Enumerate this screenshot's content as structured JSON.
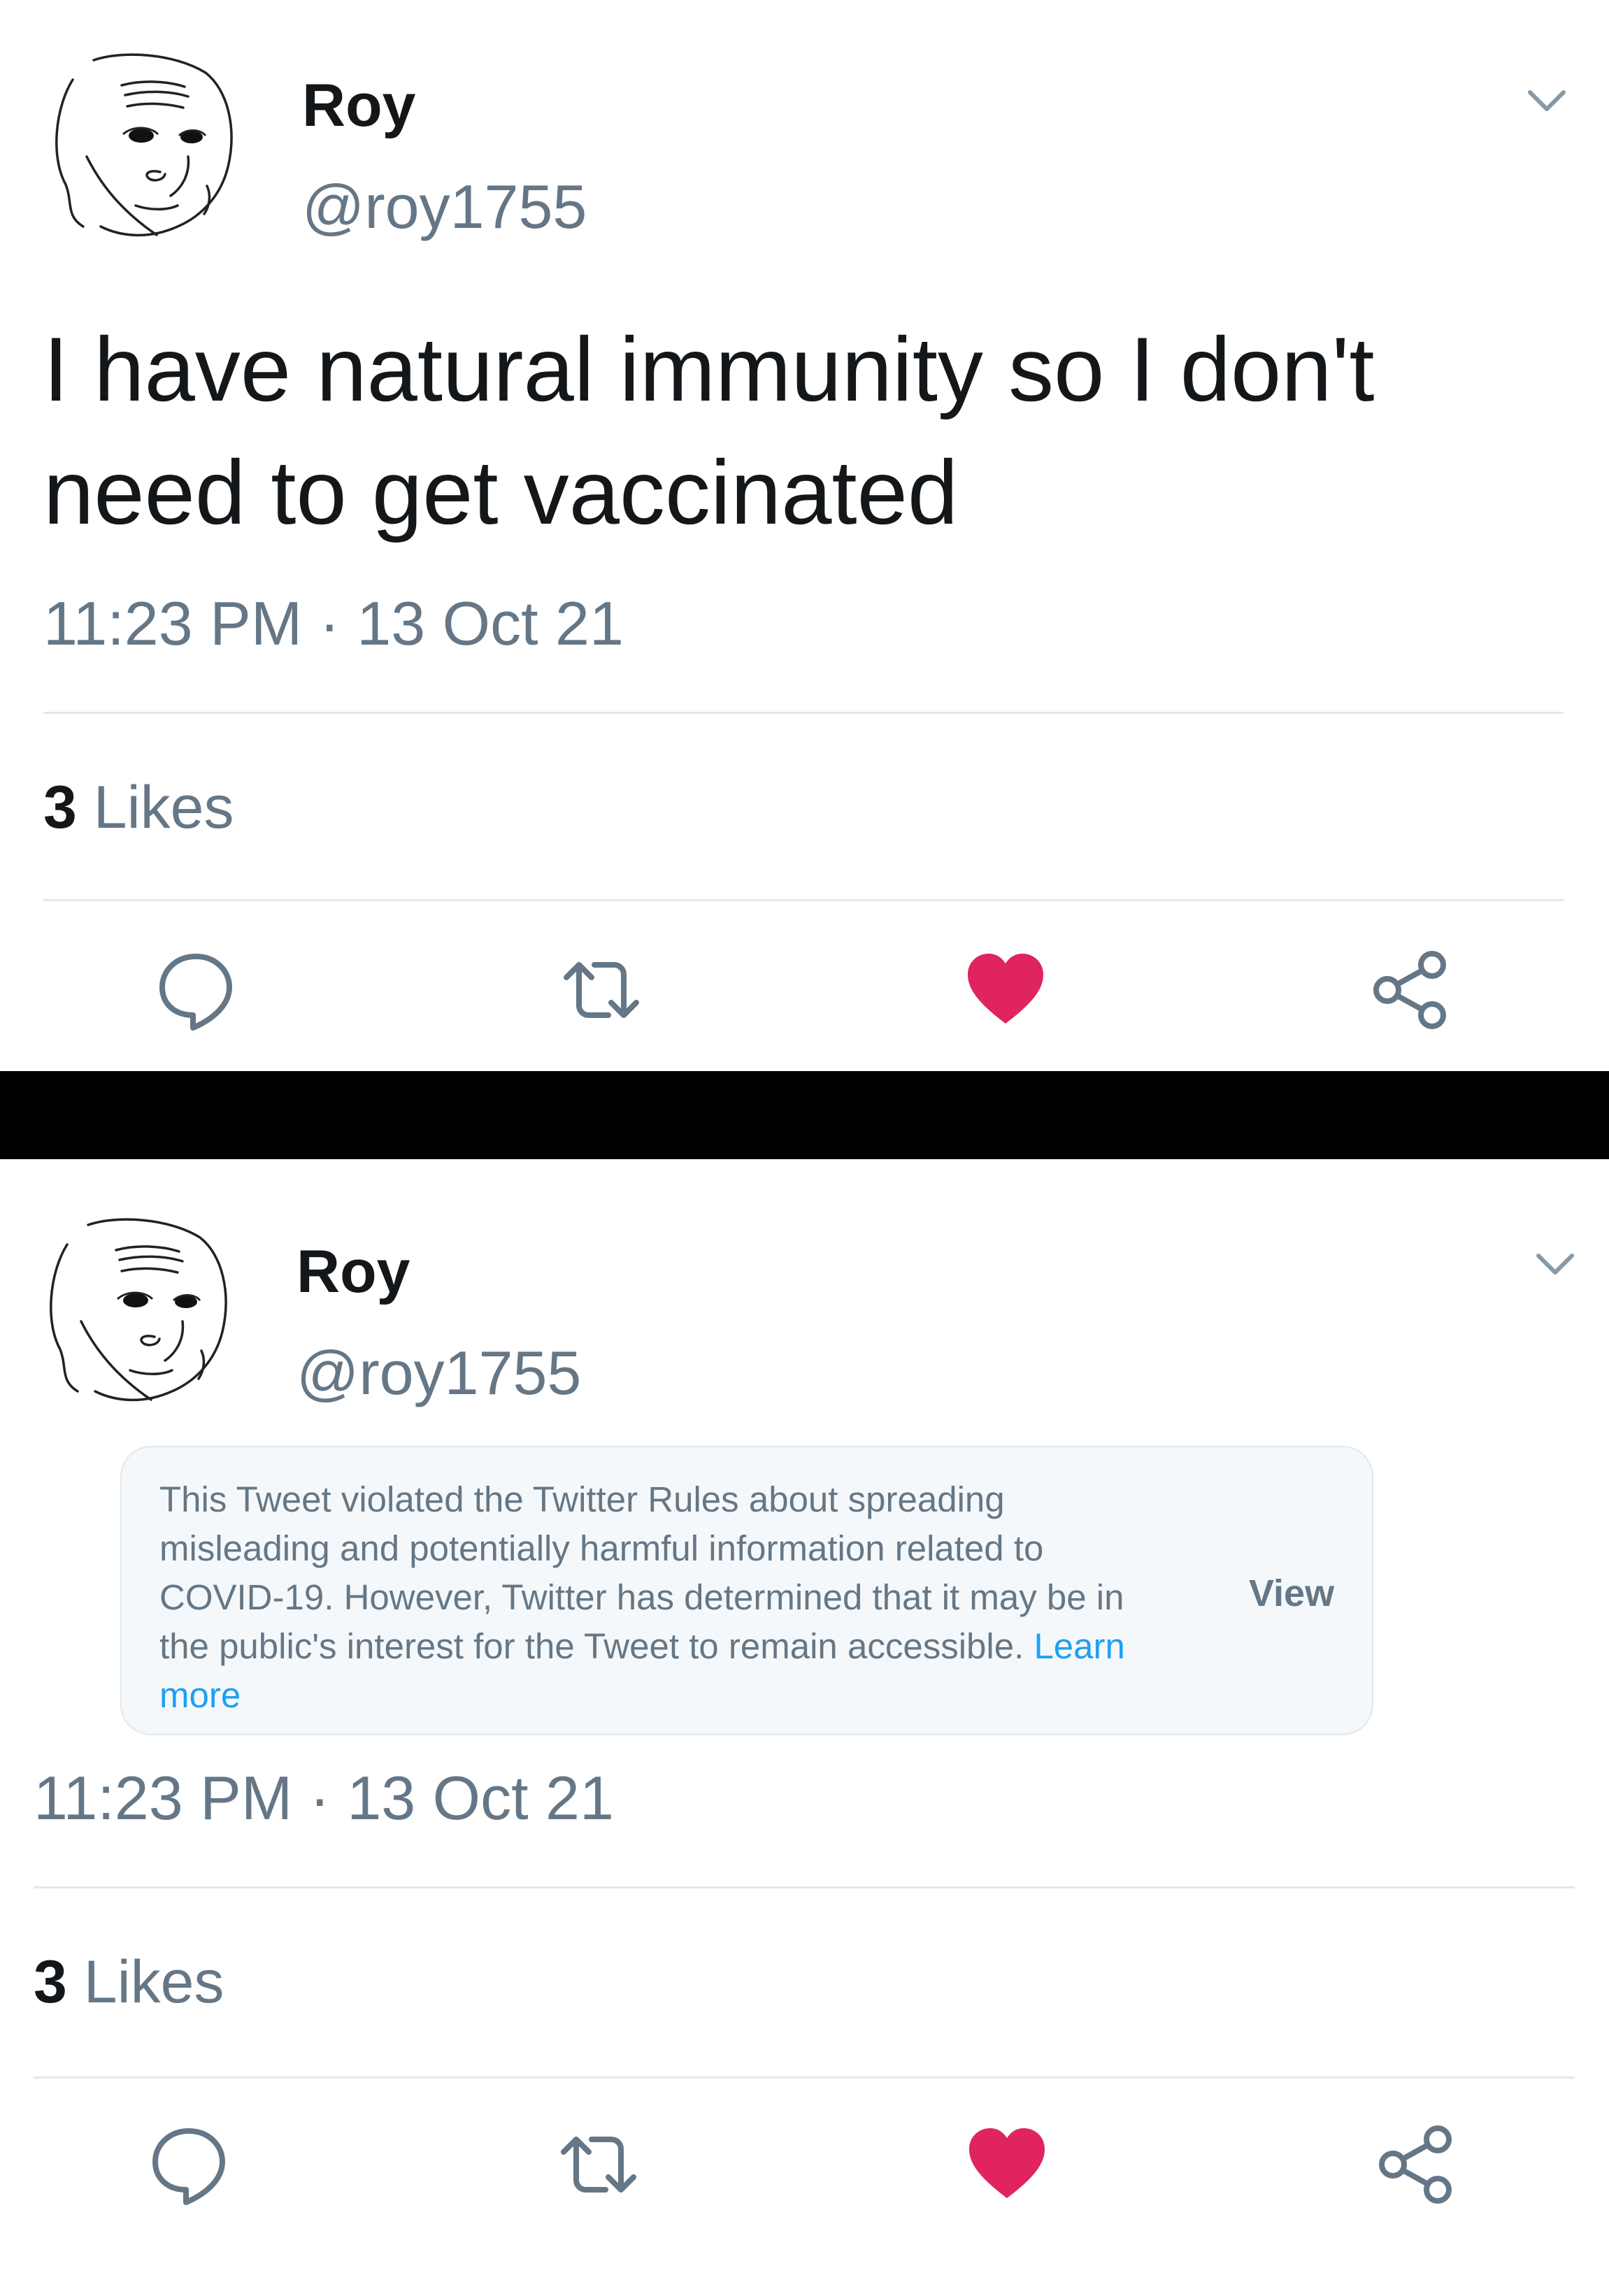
{
  "colors": {
    "text_primary": "#14171a",
    "text_secondary": "#657786",
    "link": "#1da1f2",
    "like_active": "#e0245e",
    "divider": "#e1e8ed",
    "separator_bar": "#000000"
  },
  "tweet_before": {
    "author_name": "Roy",
    "author_handle": "@roy1755",
    "text": "I have natural immunity so I don't need to get vaccinated",
    "timestamp": "11:23 PM · 13 Oct 21",
    "likes_count": "3",
    "likes_label": "Likes",
    "actions": [
      "reply-icon",
      "retweet-icon",
      "like-icon",
      "share-icon"
    ],
    "liked": true
  },
  "tweet_after": {
    "author_name": "Roy",
    "author_handle": "@roy1755",
    "notice_text": "This Tweet violated the Twitter Rules about spreading misleading and potentially harmful information related to COVID-19. However, Twitter has determined that it may be in the public's interest for the Tweet to remain accessible.",
    "notice_link": "Learn more",
    "notice_view": "View",
    "timestamp": "11:23 PM · 13 Oct 21",
    "likes_count": "3",
    "likes_label": "Likes",
    "actions": [
      "reply-icon",
      "retweet-icon",
      "like-icon",
      "share-icon"
    ],
    "liked": true
  }
}
